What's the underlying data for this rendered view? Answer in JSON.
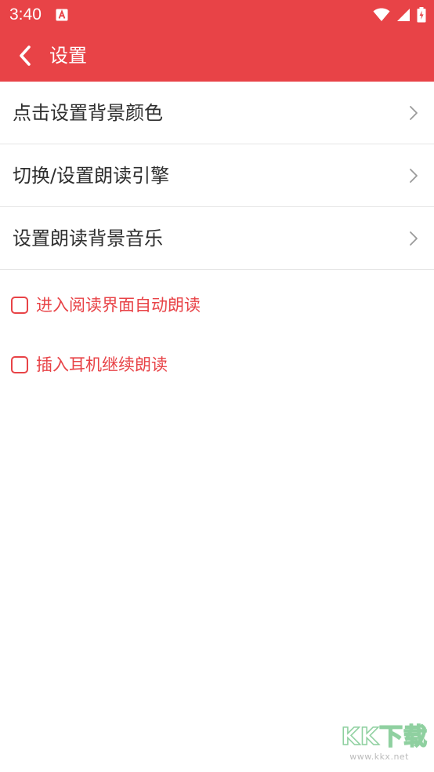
{
  "status_bar": {
    "time": "3:40",
    "app_icon": "a-app-icon",
    "icons": [
      "wifi-icon",
      "signal-icon",
      "battery-charging-icon"
    ]
  },
  "toolbar": {
    "back_icon": "chevron-left-icon",
    "title": "设置"
  },
  "menu": {
    "items": [
      {
        "label": "点击设置背景颜色",
        "icon": "chevron-right-icon"
      },
      {
        "label": "切换/设置朗读引擎",
        "icon": "chevron-right-icon"
      },
      {
        "label": "设置朗读背景音乐",
        "icon": "chevron-right-icon"
      }
    ]
  },
  "options": [
    {
      "label": "进入阅读界面自动朗读",
      "checked": false
    },
    {
      "label": "插入耳机继续朗读",
      "checked": false
    }
  ],
  "watermark": {
    "title": "KK下载",
    "url": "www.kkx.net"
  },
  "colors": {
    "accent": "#e84347",
    "text_primary": "#2e2e2e",
    "divider": "#e6e6e6",
    "chevron": "#9a9a9a"
  }
}
